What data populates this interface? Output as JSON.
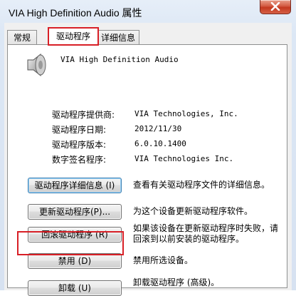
{
  "window": {
    "title": "VIA High Definition Audio 属性"
  },
  "tabs": [
    {
      "label": "常规"
    },
    {
      "label": "驱动程序"
    },
    {
      "label": "详细信息"
    }
  ],
  "device": {
    "name": "VIA High Definition Audio"
  },
  "driver_info": [
    {
      "label": "驱动程序提供商:",
      "value": "VIA Technologies, Inc."
    },
    {
      "label": "驱动程序日期:",
      "value": "2012/11/30"
    },
    {
      "label": "驱动程序版本:",
      "value": "6.0.10.1400"
    },
    {
      "label": "数字签名程序:",
      "value": "VIA Technologies Inc."
    }
  ],
  "actions": [
    {
      "button": "驱动程序详细信息 (I)",
      "description": "查看有关驱动程序文件的详细信息。"
    },
    {
      "button": "更新驱动程序(P)...",
      "description": "为这个设备更新驱动程序软件。"
    },
    {
      "button": "回滚驱动程序 (R)",
      "description": "如果该设备在更新驱动程序时失败，请回滚到以前安装的驱动程序。"
    },
    {
      "button": "禁用 (D)",
      "description": "禁用所选设备。"
    },
    {
      "button": "卸载 (U)",
      "description": "卸载驱动程序 (高级)。"
    }
  ],
  "colors": {
    "highlight_box": "#d81f26",
    "close_button": "#c3391f"
  }
}
